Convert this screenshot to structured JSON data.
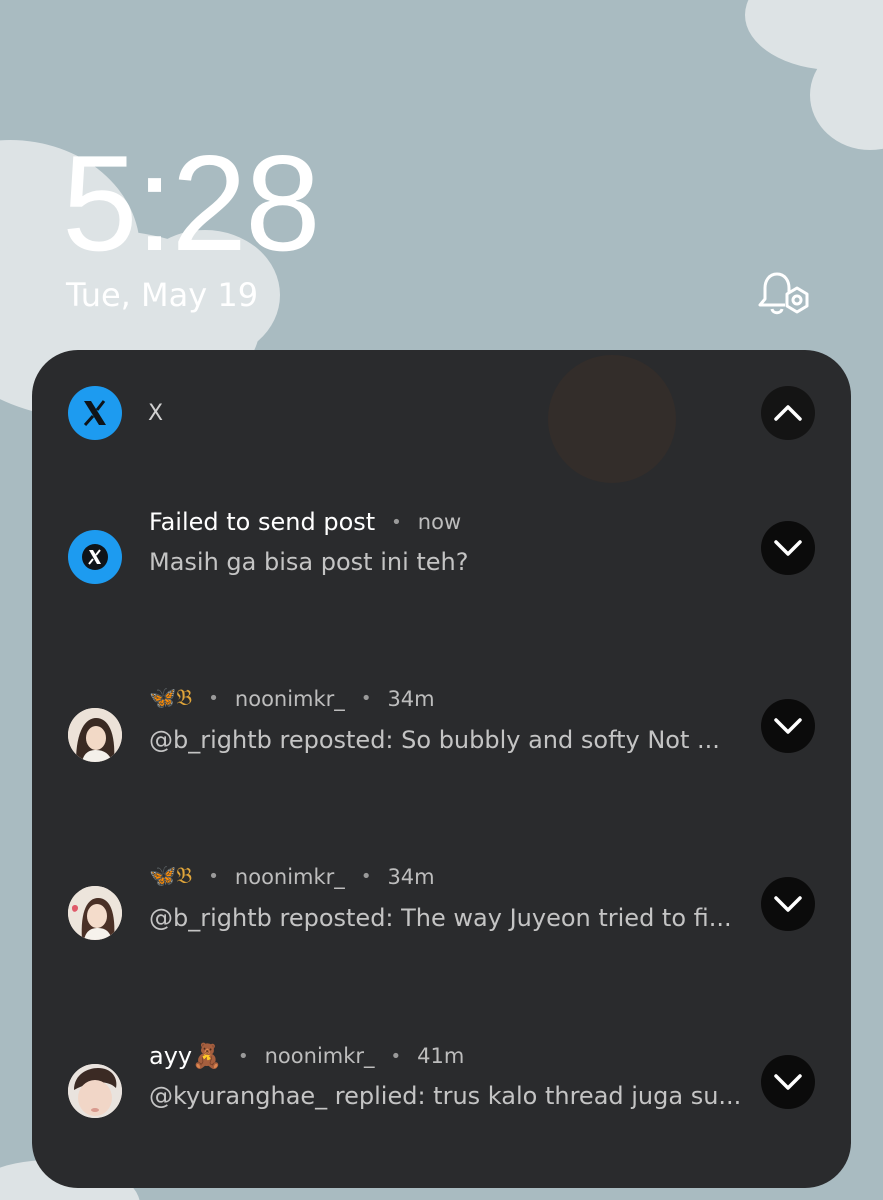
{
  "lockscreen": {
    "time": "5:28",
    "date": "Tue, May 19"
  },
  "icons": {
    "bell": "notification-settings-icon",
    "app": "x-logo-icon",
    "collapse": "chevron-up-icon",
    "expand": "chevron-down-icon"
  },
  "colors": {
    "wallpaper": "#a9bbc1",
    "panel": "#2a2b2d",
    "x_blue": "#1d9bf0",
    "button": "#0b0b0b"
  },
  "notification_group": {
    "app_name": "X",
    "items": [
      {
        "title": "Failed to send post",
        "time": "now",
        "body": "Masih ga bisa post ini teh?"
      },
      {
        "title": "🦋𝔅",
        "account": "noonimkr_",
        "time": "34m",
        "body": "@b_rightb reposted: So bubbly and softy  Not ..."
      },
      {
        "title": "🦋𝔅",
        "account": "noonimkr_",
        "time": "34m",
        "body": "@b_rightb reposted: The way Juyeon tried to fi..."
      },
      {
        "title": "ayy🧸",
        "account": "noonimkr_",
        "time": "41m",
        "body": "@kyuranghae_ replied: trus kalo thread juga su..."
      }
    ]
  }
}
